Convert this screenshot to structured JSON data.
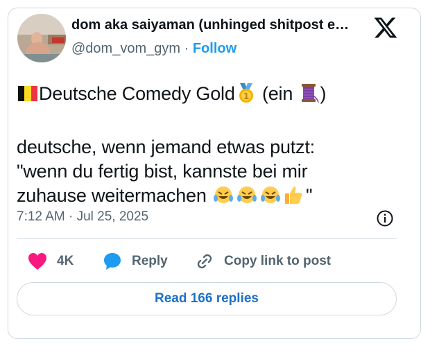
{
  "author": {
    "display_name": "dom aka saiyaman (unhinged shitpost e…",
    "handle": "@dom_vom_gym",
    "separator": "·",
    "follow_label": "Follow"
  },
  "post": {
    "line1_text_a": "Deutsche Comedy Gold",
    "line1_text_b": " (ein ",
    "line1_text_c": ")",
    "line2": "deutsche, wenn jemand etwas putzt:",
    "line3": "\"wenn du fertig bist, kannste bei mir",
    "line4_text": "zuhause weitermachen ",
    "line4_end": "\"",
    "timestamp": "7:12 AM · Jul 25, 2025"
  },
  "actions": {
    "like_count": "4K",
    "reply_label": "Reply",
    "copy_label": "Copy link to post"
  },
  "footer": {
    "read_replies_label": "Read 166 replies"
  },
  "colors": {
    "accent": "#1d9bf0",
    "like": "#f91880",
    "reply_bubble": "#1d9bf0",
    "text": "#0f1419",
    "muted": "#536471",
    "border": "#cfd9de"
  },
  "icons": [
    "x-logo-icon",
    "belgium-flag-icon",
    "gold-medal-icon",
    "thread-spool-icon",
    "rofl-icon",
    "thumbs-up-icon",
    "info-icon",
    "heart-icon",
    "reply-bubble-icon",
    "link-icon"
  ]
}
